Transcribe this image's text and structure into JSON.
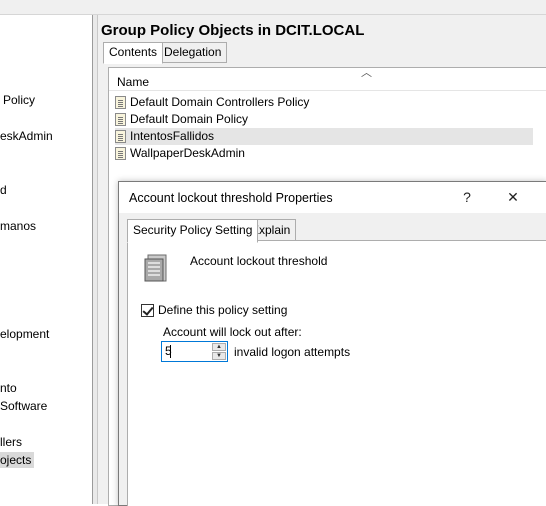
{
  "left_tree": {
    "items": [
      {
        "label": "Policy",
        "selected": false
      },
      {
        "label": "eskAdmin",
        "selected": false
      },
      {
        "label": "d",
        "selected": false
      },
      {
        "label": "manos",
        "selected": false
      },
      {
        "label": "elopment",
        "selected": false
      },
      {
        "label": "nto",
        "selected": false
      },
      {
        "label": "Software",
        "selected": false
      },
      {
        "label": "llers",
        "selected": false
      },
      {
        "label": "ojects",
        "selected": true
      }
    ]
  },
  "gpo_container": {
    "title": "Group Policy Objects in DCIT.LOCAL",
    "tabs": [
      {
        "label": "Contents",
        "active": true
      },
      {
        "label": "Delegation",
        "active": false
      }
    ],
    "column_header": "Name",
    "rows": [
      {
        "name": "Default Domain Controllers Policy",
        "selected": false
      },
      {
        "name": "Default Domain Policy",
        "selected": false
      },
      {
        "name": "IntentosFallidos",
        "selected": true
      },
      {
        "name": "WallpaperDeskAdmin",
        "selected": false
      }
    ]
  },
  "dialog": {
    "title": "Account lockout threshold Properties",
    "help_glyph": "?",
    "close_glyph": "✕",
    "tabs": [
      {
        "label": "Security Policy Setting",
        "active": true
      },
      {
        "label": "Explain",
        "active": false
      }
    ],
    "policy_name": "Account lockout threshold",
    "define_checkbox": {
      "label": "Define this policy setting",
      "checked": true
    },
    "lockout_label": "Account will lock out after:",
    "lockout_value": "5",
    "lockout_unit": "invalid logon attempts"
  },
  "icons": {
    "policy_doc": "policy-document-icon",
    "server": "server-stack-icon",
    "sort": "sort-ascending-icon"
  }
}
